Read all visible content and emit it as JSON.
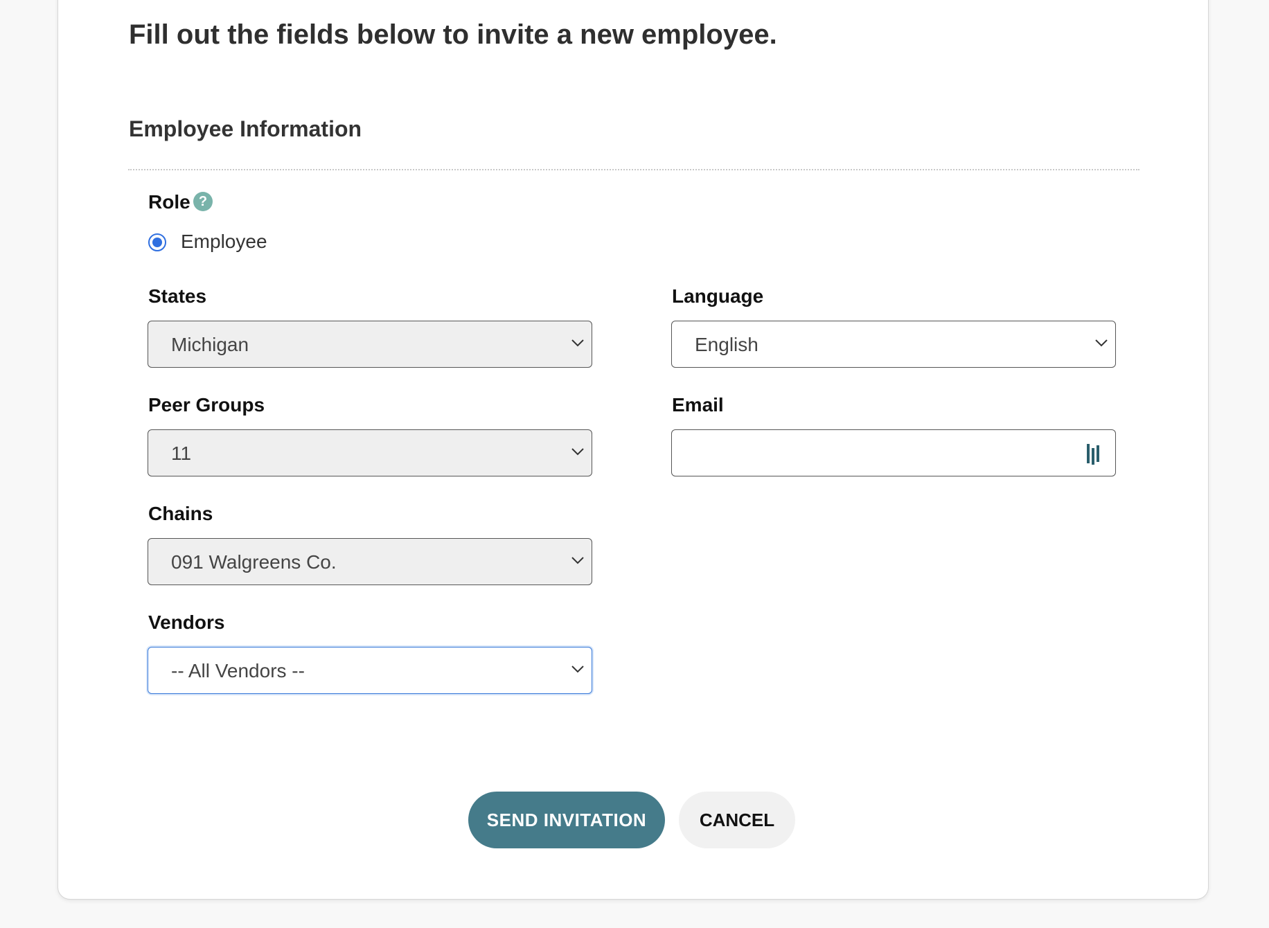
{
  "intro": "Fill out the fields below to invite a new employee.",
  "section_title": "Employee Information",
  "role": {
    "label": "Role",
    "help_icon": "?",
    "option_label": "Employee",
    "selected": true
  },
  "states": {
    "label": "States",
    "value": "Michigan"
  },
  "language": {
    "label": "Language",
    "value": "English"
  },
  "peer_groups": {
    "label": "Peer Groups",
    "value": "11"
  },
  "email": {
    "label": "Email",
    "value": ""
  },
  "chains": {
    "label": "Chains",
    "value": "091 Walgreens Co."
  },
  "vendors": {
    "label": "Vendors",
    "value": "-- All Vendors --"
  },
  "buttons": {
    "send": "SEND INVITATION",
    "cancel": "CANCEL"
  },
  "colors": {
    "primary": "#457b8a",
    "help_icon": "#79b3aa",
    "radio": "#2f6fe0"
  },
  "icons": {
    "help": "question-circle-icon",
    "select_chevron": "chevron-down-icon",
    "email_autofill": "dashlane-icon"
  }
}
